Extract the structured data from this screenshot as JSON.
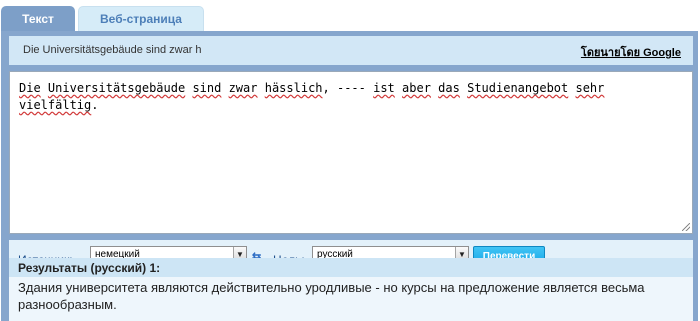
{
  "tabs": [
    {
      "label": "Текст",
      "active": true
    },
    {
      "label": "Веб-страница",
      "active": false
    }
  ],
  "source_line": {
    "text": "Die Universitätsgebäude sind zwar h",
    "attribution": "โดยนายโดย Google"
  },
  "input": {
    "words": [
      {
        "t": "Die",
        "sp": true
      },
      {
        "t": " "
      },
      {
        "t": "Universitätsgebäude",
        "sp": true
      },
      {
        "t": " "
      },
      {
        "t": "sind",
        "sp": true
      },
      {
        "t": " "
      },
      {
        "t": "zwar",
        "sp": true
      },
      {
        "t": " "
      },
      {
        "t": "hässlich",
        "sp": true
      },
      {
        "t": ", "
      },
      {
        "t": "----",
        "sp": false
      },
      {
        "t": " "
      },
      {
        "t": "ist",
        "sp": true
      },
      {
        "t": " "
      },
      {
        "t": "aber",
        "sp": true
      },
      {
        "t": " "
      },
      {
        "t": "das",
        "sp": true
      },
      {
        "t": " "
      },
      {
        "t": "Studienangebot",
        "sp": true
      },
      {
        "t": " "
      },
      {
        "t": "sehr",
        "sp": true
      },
      {
        "t": "\n"
      },
      {
        "t": "vielfältig",
        "sp": true
      },
      {
        "t": "."
      }
    ]
  },
  "controls": {
    "source_label": "Источник:",
    "source_language": "немецкий",
    "target_label": "Цель:",
    "target_language": "русский",
    "translate_button": "Перевести"
  },
  "results": {
    "header": "Результаты (русский) 1:",
    "text": "Здания университета являются действительно уродливые - но курсы на предложение является весьма разнообразным."
  },
  "colors": {
    "panel": "#86a6cd",
    "tab_active": "#7d9fc8",
    "tab_inactive": "#d6ecf8",
    "button": "#1aa9e8",
    "label_text": "#1e4f8c"
  },
  "icons": {
    "swap": "swap-languages-icon",
    "dropdown": "chevron-down-icon",
    "resize": "resize-grip-icon"
  }
}
